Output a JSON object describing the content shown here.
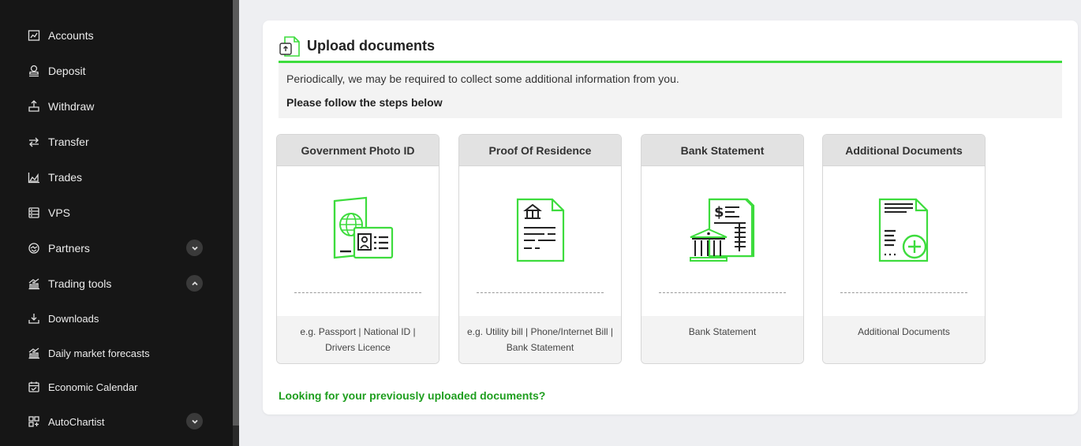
{
  "sidebar": {
    "items": [
      {
        "label": "Accounts",
        "icon": "chart-icon"
      },
      {
        "label": "Deposit",
        "icon": "deposit-icon"
      },
      {
        "label": "Withdraw",
        "icon": "withdraw-icon"
      },
      {
        "label": "Transfer",
        "icon": "transfer-icon"
      },
      {
        "label": "Trades",
        "icon": "area-chart-icon"
      },
      {
        "label": "VPS",
        "icon": "server-icon"
      },
      {
        "label": "Partners",
        "icon": "handshake-icon",
        "expandable": "collapsed"
      },
      {
        "label": "Trading tools",
        "icon": "bar-chart-icon",
        "expandable": "expanded"
      },
      {
        "label": "Downloads",
        "icon": "download-icon"
      },
      {
        "label": "Daily market forecasts",
        "icon": "bar-chart-icon"
      },
      {
        "label": "Economic Calendar",
        "icon": "calendar-icon"
      },
      {
        "label": "AutoChartist",
        "icon": "grid-plus-icon",
        "expandable": "collapsed"
      }
    ]
  },
  "upload": {
    "title": "Upload documents",
    "intro": "Periodically, we may be required to collect some additional information from you.",
    "steps": "Please follow the steps below",
    "cards": [
      {
        "title": "Government Photo ID",
        "description": "e.g. Passport | National ID | Drivers Licence",
        "icon": "passport-icon"
      },
      {
        "title": "Proof Of Residence",
        "description": "e.g. Utility bill | Phone/Internet Bill | Bank Statement",
        "icon": "residence-document-icon"
      },
      {
        "title": "Bank Statement",
        "description": "Bank Statement",
        "icon": "bank-statement-icon"
      },
      {
        "title": "Additional Documents",
        "description": "Additional Documents",
        "icon": "add-document-icon"
      }
    ],
    "previous_link": "Looking for your previously uploaded documents?"
  },
  "colors": {
    "accent_green": "#3ddc3d",
    "link_green": "#1e9e1e",
    "sidebar_bg": "#161616"
  }
}
